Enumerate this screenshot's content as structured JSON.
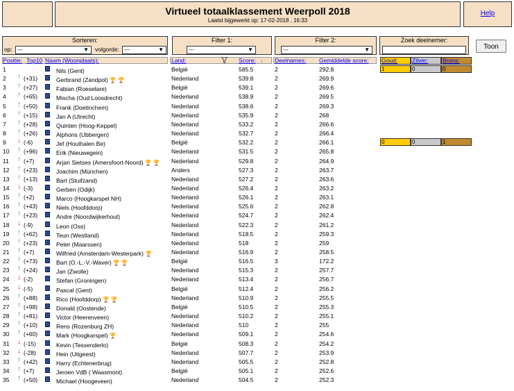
{
  "header": {
    "title": "Virtueel totaalklassement Weerpoll 2018",
    "updated": "Laatst bijgewerkt op: 17-02-2018 , 16:33",
    "help_label": "Help"
  },
  "controls": {
    "sort_title": "Sorteren:",
    "op_label": "op:",
    "op_value": "---",
    "order_label": "volgorde:",
    "order_value": "---",
    "filter1_title": "Filter 1:",
    "filter1_value": "---",
    "filter2_title": "Filter 2:",
    "filter2_value": "---",
    "search_title": "Zoek deelnemer:",
    "search_value": "",
    "show_button": "Toon"
  },
  "columns": {
    "pos": "Positie:",
    "top10": "Top10",
    "name": "Naam (Woonplaats):",
    "land": "Land:",
    "score": "Score:",
    "names": "Deelnames:",
    "avg": "Gemiddelde score:",
    "gold": "Goud:",
    "silver": "Zilver:",
    "bronze": "Brons:",
    "filter_icon": "funnel-icon",
    "sort_icon": "arrow-down-icon"
  },
  "colors": {
    "panel": "#f5e0c6",
    "gold": "#ffcc00",
    "silver": "#c8c8c8",
    "bronze": "#c08a30",
    "up": "#22aa22",
    "down": "#dd2222"
  },
  "rows": [
    {
      "pos": "1",
      "dir": "",
      "chg": "",
      "name": "Nils (Gent)",
      "trophies": "",
      "land": "België",
      "score": "585.5",
      "n": "2",
      "avg": "292.8",
      "medals": [
        "1",
        "0",
        "0"
      ]
    },
    {
      "pos": "2",
      "dir": "up",
      "chg": "(+31)",
      "name": "Gerbrand (Zandpol)",
      "trophies": "bb",
      "land": "Nederland",
      "score": "539.8",
      "n": "2",
      "avg": "269.9",
      "medals": null
    },
    {
      "pos": "3",
      "dir": "up",
      "chg": "(+27)",
      "name": "Fabian (Roeselare)",
      "trophies": "",
      "land": "België",
      "score": "539.1",
      "n": "2",
      "avg": "269.6",
      "medals": null
    },
    {
      "pos": "4",
      "dir": "up",
      "chg": "(+65)",
      "name": "Mischa (Oud Loosdrecht)",
      "trophies": "",
      "land": "Nederland",
      "score": "538.9",
      "n": "2",
      "avg": "269.5",
      "medals": null
    },
    {
      "pos": "5",
      "dir": "up",
      "chg": "(+50)",
      "name": "Frank (Doetinchem)",
      "trophies": "",
      "land": "Nederland",
      "score": "538.6",
      "n": "2",
      "avg": "269.3",
      "medals": null
    },
    {
      "pos": "6",
      "dir": "up",
      "chg": "(+15)",
      "name": "Jan A (Utrecht)",
      "trophies": "",
      "land": "Nederland",
      "score": "535.9",
      "n": "2",
      "avg": "268",
      "medals": null
    },
    {
      "pos": "7",
      "dir": "up",
      "chg": "(+28)",
      "name": "Quinten (Hoog-Keppel)",
      "trophies": "",
      "land": "Nederland",
      "score": "533.2",
      "n": "2",
      "avg": "266.6",
      "medals": null
    },
    {
      "pos": "8",
      "dir": "up",
      "chg": "(+26)",
      "name": "Alphons (Ubbergen)",
      "trophies": "",
      "land": "Nederland",
      "score": "532.7",
      "n": "2",
      "avg": "266.4",
      "medals": null
    },
    {
      "pos": "9",
      "dir": "down",
      "chg": "(-6)",
      "name": "Jef (Houthalen Be)",
      "trophies": "",
      "land": "België",
      "score": "532.2",
      "n": "2",
      "avg": "266.1",
      "medals": [
        "0",
        "0",
        "1"
      ]
    },
    {
      "pos": "10",
      "dir": "up",
      "chg": "(+96)",
      "name": "Erik (Nieuwegein)",
      "trophies": "",
      "land": "Nederland",
      "score": "531.5",
      "n": "2",
      "avg": "265.8",
      "medals": null
    },
    {
      "pos": "11",
      "dir": "up",
      "chg": "(+7)",
      "name": "Arjan Sietses (Amersfoort-Noord)",
      "trophies": "gs",
      "land": "Nederland",
      "score": "529.8",
      "n": "2",
      "avg": "264.9",
      "medals": null
    },
    {
      "pos": "12",
      "dir": "up",
      "chg": "(+23)",
      "name": "Joachim (München)",
      "trophies": "",
      "land": "Anders",
      "score": "527.3",
      "n": "2",
      "avg": "263.7",
      "medals": null
    },
    {
      "pos": "13",
      "dir": "up",
      "chg": "(+13)",
      "name": "Bart (Stuifzand)",
      "trophies": "",
      "land": "Nederland",
      "score": "527.2",
      "n": "2",
      "avg": "263.6",
      "medals": null
    },
    {
      "pos": "14",
      "dir": "down",
      "chg": "(-3)",
      "name": "Gerben (Odijk)",
      "trophies": "",
      "land": "Nederland",
      "score": "526.4",
      "n": "2",
      "avg": "263.2",
      "medals": null
    },
    {
      "pos": "15",
      "dir": "up",
      "chg": "(+2)",
      "name": "Marco (Hoogkarspel NH)",
      "trophies": "",
      "land": "Nederland",
      "score": "526.1",
      "n": "2",
      "avg": "263.1",
      "medals": null
    },
    {
      "pos": "16",
      "dir": "up",
      "chg": "(+43)",
      "name": "Niels (Hoofddorp)",
      "trophies": "",
      "land": "Nederland",
      "score": "525.6",
      "n": "2",
      "avg": "262.8",
      "medals": null
    },
    {
      "pos": "17",
      "dir": "up",
      "chg": "(+23)",
      "name": "Andre (Noordwijkerhout)",
      "trophies": "",
      "land": "Nederland",
      "score": "524.7",
      "n": "2",
      "avg": "262.4",
      "medals": null
    },
    {
      "pos": "18",
      "dir": "down",
      "chg": "(-9)",
      "name": "Leon (Oss)",
      "trophies": "",
      "land": "Nederland",
      "score": "522.3",
      "n": "2",
      "avg": "261.2",
      "medals": null
    },
    {
      "pos": "19",
      "dir": "up",
      "chg": "(+62)",
      "name": "Teun (Westland)",
      "trophies": "",
      "land": "Nederland",
      "score": "518.5",
      "n": "2",
      "avg": "259.3",
      "medals": null
    },
    {
      "pos": "20",
      "dir": "up",
      "chg": "(+23)",
      "name": "Peter (Maarssen)",
      "trophies": "",
      "land": "Nederland",
      "score": "518",
      "n": "2",
      "avg": "259",
      "medals": null
    },
    {
      "pos": "21",
      "dir": "up",
      "chg": "(+7)",
      "name": "Wilfried (Amsterdam-Westerpark)",
      "trophies": "b",
      "land": "Nederland",
      "score": "516.9",
      "n": "2",
      "avg": "258.5",
      "medals": null
    },
    {
      "pos": "22",
      "dir": "up",
      "chg": "(+73)",
      "name": "Bart (O.-L.-V.-Waver)",
      "trophies": "gg",
      "land": "België",
      "score": "516.5",
      "n": "3",
      "avg": "172.2",
      "medals": null
    },
    {
      "pos": "23",
      "dir": "up",
      "chg": "(+24)",
      "name": "Jan (Zwolle)",
      "trophies": "",
      "land": "Nederland",
      "score": "515.3",
      "n": "2",
      "avg": "257.7",
      "medals": null
    },
    {
      "pos": "24",
      "dir": "down",
      "chg": "(-2)",
      "name": "Stefan (Groningen)",
      "trophies": "",
      "land": "Nederland",
      "score": "513.4",
      "n": "2",
      "avg": "256.7",
      "medals": null
    },
    {
      "pos": "25",
      "dir": "down",
      "chg": "(-5)",
      "name": "Pascal (Gent)",
      "trophies": "",
      "land": "België",
      "score": "512.4",
      "n": "2",
      "avg": "256.2",
      "medals": null
    },
    {
      "pos": "26",
      "dir": "up",
      "chg": "(+88)",
      "name": "Rico (Hoofddorp)",
      "trophies": "gb",
      "land": "Nederland",
      "score": "510.9",
      "n": "2",
      "avg": "255.5",
      "medals": null
    },
    {
      "pos": "27",
      "dir": "up",
      "chg": "(+98)",
      "name": "Donald (Oostende)",
      "trophies": "",
      "land": "België",
      "score": "510.5",
      "n": "2",
      "avg": "255.3",
      "medals": null
    },
    {
      "pos": "28",
      "dir": "up",
      "chg": "(+81)",
      "name": "Victor (Heerenveen)",
      "trophies": "",
      "land": "Nederland",
      "score": "510.2",
      "n": "2",
      "avg": "255.1",
      "medals": null
    },
    {
      "pos": "29",
      "dir": "up",
      "chg": "(+10)",
      "name": "Rens (Rozenburg ZH)",
      "trophies": "",
      "land": "Nederland",
      "score": "510",
      "n": "2",
      "avg": "255",
      "medals": null
    },
    {
      "pos": "30",
      "dir": "up",
      "chg": "(+60)",
      "name": "Mark (Hoogkarspel)",
      "trophies": "s",
      "land": "Nederland",
      "score": "509.1",
      "n": "2",
      "avg": "254.6",
      "medals": null
    },
    {
      "pos": "31",
      "dir": "down",
      "chg": "(-15)",
      "name": "Kevin (Tessenderlo)",
      "trophies": "",
      "land": "België",
      "score": "508.3",
      "n": "2",
      "avg": "254.2",
      "medals": null
    },
    {
      "pos": "32",
      "dir": "down",
      "chg": "(-28)",
      "name": "Hein (Uitgeest)",
      "trophies": "",
      "land": "Nederland",
      "score": "507.7",
      "n": "2",
      "avg": "253.9",
      "medals": null
    },
    {
      "pos": "33",
      "dir": "up",
      "chg": "(+42)",
      "name": "Harry (Echtenerbrug)",
      "trophies": "",
      "land": "Nederland",
      "score": "505.5",
      "n": "2",
      "avg": "252.8",
      "medals": null
    },
    {
      "pos": "34",
      "dir": "up",
      "chg": "(+7)",
      "name": "Jeroen VdB ( Waasmont)",
      "trophies": "",
      "land": "België",
      "score": "505.1",
      "n": "2",
      "avg": "252.6",
      "medals": null
    },
    {
      "pos": "35",
      "dir": "up",
      "chg": "(+50)",
      "name": "Michael (Hoogeveen)",
      "trophies": "",
      "land": "Nederland",
      "score": "504.5",
      "n": "2",
      "avg": "252.3",
      "medals": null
    }
  ]
}
